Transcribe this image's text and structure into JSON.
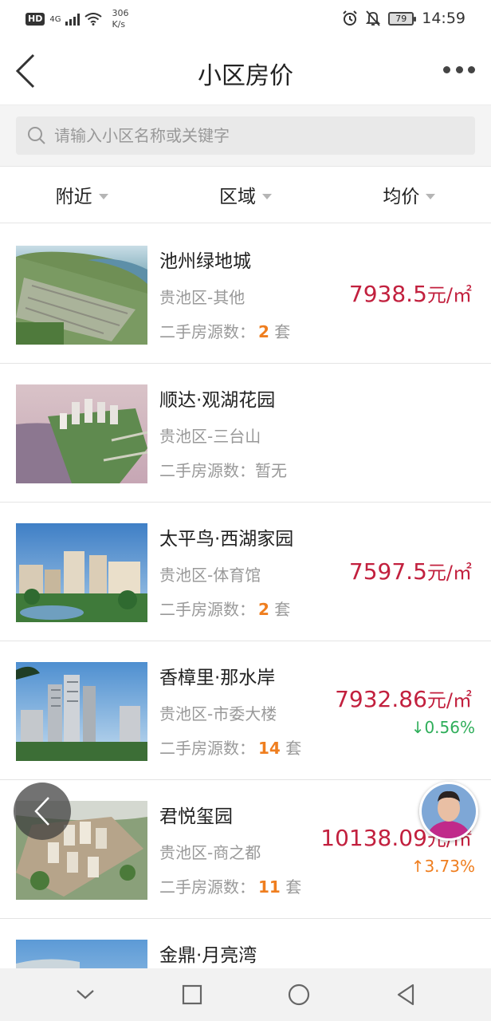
{
  "status_bar": {
    "hd": "HD",
    "network": "4G",
    "speed_value": "306",
    "speed_unit": "K/s",
    "battery": "79",
    "time": "14:59"
  },
  "header": {
    "title": "小区房价"
  },
  "search": {
    "placeholder": "请输入小区名称或关键字"
  },
  "filters": [
    {
      "label": "附近"
    },
    {
      "label": "区域"
    },
    {
      "label": "均价"
    }
  ],
  "listings": [
    {
      "name": "池州绿地城",
      "area": "贵池区-其他",
      "listings_label": "二手房源数：",
      "listings_count": "2",
      "listings_suffix": "套",
      "price": "7938.5",
      "unit": "元/㎡",
      "change": ""
    },
    {
      "name": "顺达·观湖花园",
      "area": "贵池区-三台山",
      "listings_label": "二手房源数：",
      "listings_none": "暂无",
      "price": "",
      "unit": "",
      "change": ""
    },
    {
      "name": "太平鸟·西湖家园",
      "area": "贵池区-体育馆",
      "listings_label": "二手房源数：",
      "listings_count": "2",
      "listings_suffix": "套",
      "price": "7597.5",
      "unit": "元/㎡",
      "change": ""
    },
    {
      "name": "香樟里·那水岸",
      "area": "贵池区-市委大楼",
      "listings_label": "二手房源数：",
      "listings_count": "14",
      "listings_suffix": "套",
      "price": "7932.86",
      "unit": "元/㎡",
      "change": "↓0.56%"
    },
    {
      "name": "君悦玺园",
      "area": "贵池区-商之都",
      "listings_label": "二手房源数：",
      "listings_count": "11",
      "listings_suffix": "套",
      "price": "10138.09",
      "unit": "元/㎡",
      "change": "↑3.73%"
    },
    {
      "name": "金鼎·月亮湾"
    }
  ],
  "icons": {
    "back": "back-chevron-icon",
    "more": "more-dots-icon",
    "search": "search-icon",
    "nav_down": "chevron-down-icon",
    "nav_recent": "square-icon",
    "nav_home": "circle-icon",
    "nav_back": "triangle-back-icon"
  },
  "colors": {
    "price": "#c2203e",
    "count": "#ef7e1f",
    "down": "#2fae5a",
    "up": "#ef7e1f"
  }
}
